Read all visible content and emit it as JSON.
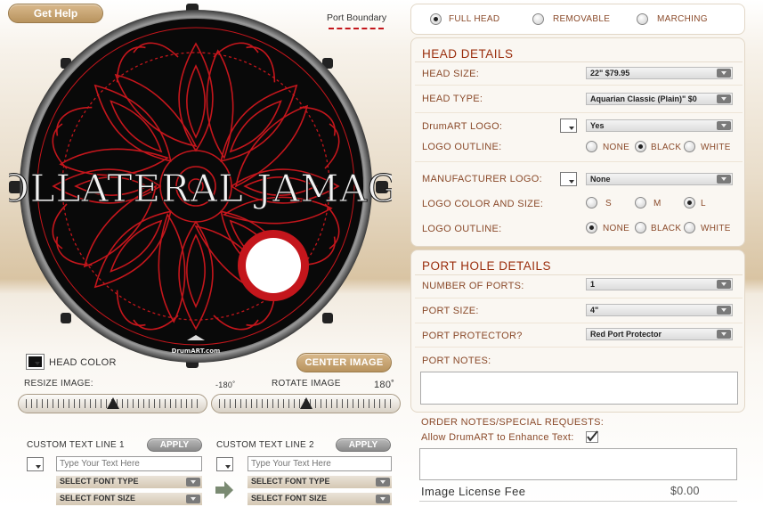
{
  "header": {
    "get_help": "Get Help",
    "port_boundary": "Port Boundary"
  },
  "drum": {
    "band_text": "COLLATERAL JAMAGE",
    "brand_mark": "DrumART.com",
    "pattern_color": "#c4161c"
  },
  "controls": {
    "head_color_label": "HEAD COLOR",
    "center_image": "CENTER IMAGE",
    "resize_label": "RESIZE IMAGE:",
    "rotate_label": "ROTATE IMAGE",
    "rotate_min": "-180˚",
    "rotate_max": "180˚",
    "resize_value": 0.5,
    "rotate_value": 0.5
  },
  "text_lines": [
    {
      "label": "CUSTOM TEXT LINE 1",
      "apply": "APPLY",
      "placeholder": "Type Your Text Here",
      "font_type": "SELECT FONT TYPE",
      "font_size": "SELECT FONT SIZE"
    },
    {
      "label": "CUSTOM TEXT LINE 2",
      "apply": "APPLY",
      "placeholder": "Type Your Text Here",
      "font_type": "SELECT FONT TYPE",
      "font_size": "SELECT FONT SIZE"
    }
  ],
  "head_type_tabs": {
    "options": [
      "FULL HEAD",
      "REMOVABLE",
      "MARCHING"
    ],
    "selected": "FULL HEAD"
  },
  "head_details": {
    "title": "HEAD DETAILS",
    "head_size_label": "HEAD SIZE:",
    "head_size_value": "22\"  $79.95",
    "head_type_label": "HEAD TYPE:",
    "head_type_value": "Aquarian Classic (Plain)\" $0",
    "drumart_logo_label": "DrumART LOGO:",
    "drumart_logo_value": "Yes",
    "logo_outline_label": "LOGO OUTLINE:",
    "logo_outline_options": [
      "NONE",
      "BLACK",
      "WHITE"
    ],
    "logo_outline_selected": "BLACK",
    "mfr_logo_label": "MANUFACTURER LOGO:",
    "mfr_logo_value": "None",
    "logo_color_size_label": "LOGO COLOR AND SIZE:",
    "logo_size_options": [
      "S",
      "M",
      "L"
    ],
    "logo_size_selected": "L",
    "logo_outline2_label": "LOGO OUTLINE:",
    "logo_outline2_options": [
      "NONE",
      "BLACK",
      "WHITE"
    ],
    "logo_outline2_selected": "NONE"
  },
  "port_details": {
    "title": "PORT HOLE DETAILS",
    "num_ports_label": "NUMBER OF PORTS:",
    "num_ports_value": "1",
    "port_size_label": "PORT SIZE:",
    "port_size_value": "4\"",
    "protector_label": "PORT PROTECTOR?",
    "protector_value": "Red Port Protector",
    "notes_label": "PORT NOTES:"
  },
  "order": {
    "notes_label": "ORDER NOTES/SPECIAL REQUESTS:",
    "enhance_label": "Allow DrumART to Enhance Text:",
    "enhance_checked": true,
    "license_label": "Image License Fee",
    "license_value": "$0.00"
  },
  "colors": {
    "accent": "#9a2d0c",
    "button_tan": "#c9a572",
    "drum_black": "#0a0a0a"
  }
}
